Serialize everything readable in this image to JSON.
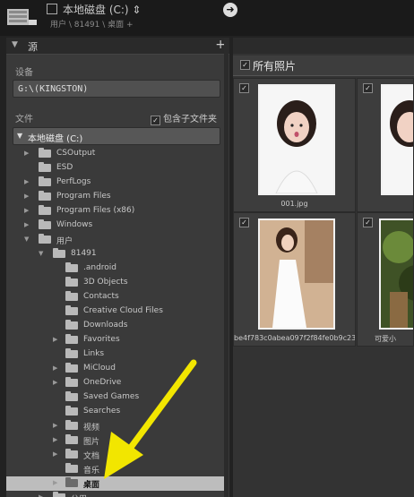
{
  "header": {
    "device_name": "本地磁盘 (C:) ⇕",
    "path": "用户 \\ 81491 \\ 桌面 +"
  },
  "left_panel": {
    "title": "源",
    "plus": "+",
    "device_label": "设备",
    "device_value": "G:\\(KINGSTON)",
    "files_label": "文件",
    "include_sub_label": "包含子文件夹",
    "volume_label": "本地磁盘 (C:)"
  },
  "tree": [
    {
      "name": "CSOutput",
      "depth": 0,
      "expander": "▶"
    },
    {
      "name": "ESD",
      "depth": 0,
      "expander": ""
    },
    {
      "name": "PerfLogs",
      "depth": 0,
      "expander": "▶"
    },
    {
      "name": "Program Files",
      "depth": 0,
      "expander": "▶"
    },
    {
      "name": "Program Files (x86)",
      "depth": 0,
      "expander": "▶"
    },
    {
      "name": "Windows",
      "depth": 0,
      "expander": "▶"
    },
    {
      "name": "用户",
      "depth": 0,
      "expander": "▼"
    },
    {
      "name": "81491",
      "depth": 1,
      "expander": "▼"
    },
    {
      "name": ".android",
      "depth": 2,
      "expander": ""
    },
    {
      "name": "3D Objects",
      "depth": 2,
      "expander": ""
    },
    {
      "name": "Contacts",
      "depth": 2,
      "expander": ""
    },
    {
      "name": "Creative Cloud Files",
      "depth": 2,
      "expander": ""
    },
    {
      "name": "Downloads",
      "depth": 2,
      "expander": ""
    },
    {
      "name": "Favorites",
      "depth": 2,
      "expander": "▶"
    },
    {
      "name": "Links",
      "depth": 2,
      "expander": ""
    },
    {
      "name": "MiCloud",
      "depth": 2,
      "expander": "▶"
    },
    {
      "name": "OneDrive",
      "depth": 2,
      "expander": "▶"
    },
    {
      "name": "Saved Games",
      "depth": 2,
      "expander": ""
    },
    {
      "name": "Searches",
      "depth": 2,
      "expander": ""
    },
    {
      "name": "视频",
      "depth": 2,
      "expander": "▶"
    },
    {
      "name": "图片",
      "depth": 2,
      "expander": "▶"
    },
    {
      "name": "文档",
      "depth": 2,
      "expander": "▶"
    },
    {
      "name": "音乐",
      "depth": 2,
      "expander": ""
    },
    {
      "name": "桌面",
      "depth": 2,
      "expander": "▶",
      "selected": true
    },
    {
      "name": "公用",
      "depth": 1,
      "expander": "▶"
    }
  ],
  "right_panel": {
    "all_photos_label": "所有照片",
    "photos": [
      {
        "caption": "001.jpg"
      },
      {
        "caption": ""
      },
      {
        "caption": "be4f783c0abea097f2f84fe0b9c23..."
      },
      {
        "caption": "可爱小"
      }
    ]
  },
  "colors": {
    "annotation_arrow": "#f2e600",
    "selected_row": "#bdbdbd"
  }
}
